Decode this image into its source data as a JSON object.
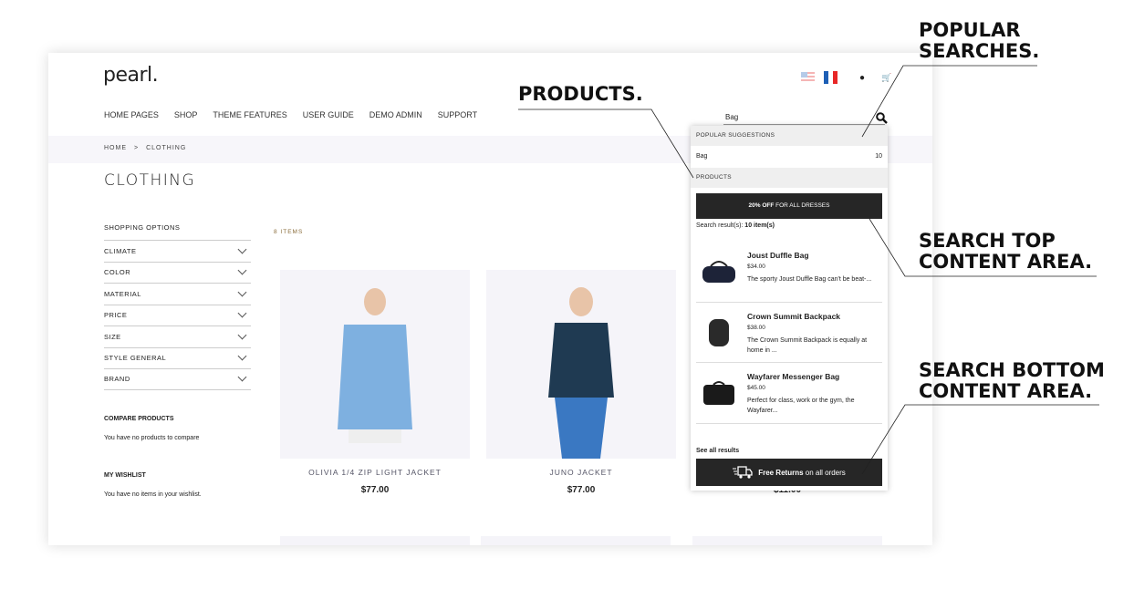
{
  "header": {
    "logo": "pearl.",
    "nav": [
      "HOME PAGES",
      "SHOP",
      "THEME FEATURES",
      "USER GUIDE",
      "DEMO ADMIN",
      "SUPPORT"
    ],
    "search_value": "Bag"
  },
  "breadcrumb": [
    "HOME",
    ">",
    "CLOTHING"
  ],
  "page_title": "CLOTHING",
  "sidebar": {
    "shopping_options": "SHOPPING OPTIONS",
    "filters": [
      "CLIMATE",
      "COLOR",
      "MATERIAL",
      "PRICE",
      "SIZE",
      "STYLE GENERAL",
      "BRAND"
    ],
    "compare_title": "COMPARE PRODUCTS",
    "compare_text": "You have no products to compare",
    "wishlist_title": "MY WISHLIST",
    "wishlist_text": "You have no items in your wishlist."
  },
  "items_count": "8 ITEMS",
  "products": [
    {
      "name": "OLIVIA 1/4 ZIP LIGHT JACKET",
      "price": "$77.00"
    },
    {
      "name": "JUNO JACKET",
      "price": "$77.00"
    },
    {
      "name": "",
      "price": "$11.00"
    }
  ],
  "dropdown": {
    "popular_header": "POPULAR SUGGESTIONS",
    "suggestion": {
      "term": "Bag",
      "count": "10"
    },
    "products_header": "PRODUCTS",
    "banner_bold": "20% OFF",
    "banner_rest": " FOR ALL DRESSES",
    "result_label": "Search result(s): ",
    "result_count": "10 item(s)",
    "items": [
      {
        "name": "Joust Duffle Bag",
        "price": "$34.00",
        "desc": "The sporty Joust Duffle Bag can't be beat-..."
      },
      {
        "name": "Crown Summit Backpack",
        "price": "$38.00",
        "desc": "The Crown Summit Backpack is equally at home in ..."
      },
      {
        "name": "Wayfarer Messenger Bag",
        "price": "$45.00",
        "desc": "Perfect for class, work or the gym, the Wayfarer..."
      }
    ],
    "see_all": "See all results",
    "bottom_bold": "Free Returns",
    "bottom_rest": " on all orders"
  },
  "annotations": {
    "popular": "POPULAR SEARCHES.",
    "products": "PRODUCTS.",
    "top": "SEARCH TOP CONTENT AREA.",
    "bottom": "SEARCH BOTTOM CONTENT AREA."
  }
}
